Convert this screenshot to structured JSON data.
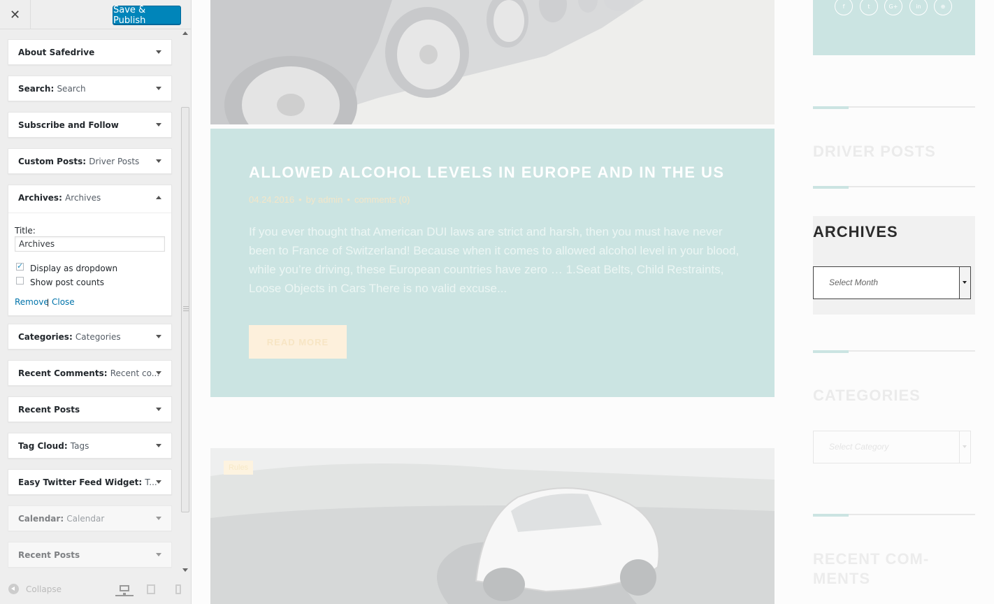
{
  "customizer": {
    "close_label": "✕",
    "save_label": "Save & Publish",
    "widgets": [
      {
        "name": "About Safedrive",
        "subtitle": ""
      },
      {
        "name": "Search",
        "subtitle": "Search"
      },
      {
        "name": "Subscribe and Follow",
        "subtitle": ""
      },
      {
        "name": "Custom Posts",
        "subtitle": "Driver Posts"
      },
      {
        "name": "Archives",
        "subtitle": "Archives"
      },
      {
        "name": "Categories",
        "subtitle": "Categories"
      },
      {
        "name": "Recent Comments",
        "subtitle": "Recent co..."
      },
      {
        "name": "Recent Posts",
        "subtitle": ""
      },
      {
        "name": "Tag Cloud",
        "subtitle": "Tags"
      },
      {
        "name": "Easy Twitter Feed Widget",
        "subtitle": "T..."
      },
      {
        "name": "Calendar",
        "subtitle": "Calendar"
      },
      {
        "name": "Recent Posts",
        "subtitle": ""
      }
    ],
    "archives_form": {
      "title_label": "Title:",
      "title_value": "Archives",
      "display_dropdown_label": "Display as dropdown",
      "display_dropdown_checked": true,
      "show_counts_label": "Show post counts",
      "show_counts_checked": false,
      "remove_label": "Remove",
      "separator": "|",
      "close_label": "Close"
    },
    "footer": {
      "collapse_label": "Collapse",
      "devices": [
        "desktop",
        "tablet",
        "mobile"
      ],
      "active_device": "desktop"
    }
  },
  "preview": {
    "post": {
      "title": "ALLOWED ALCOHOL LEVELS IN EUROPE AND IN THE US",
      "date": "04.24.2016",
      "author": "by admin",
      "comments": "comments (0)",
      "excerpt": "If you ever thought that American DUI laws are strict and harsh, then you must have never been to France of Switzerland! Because when it comes to allowed alcohol level in your blood, while you’re driving, these European countries have zero … 1.Seat Belts, Child Restraints, Loose Objects in Cars There is no valid excuse...",
      "read_more": "READ MORE"
    },
    "second_post": {
      "category_badge": "Rules"
    },
    "sidebar": {
      "social_icons": [
        "f",
        "t",
        "G+",
        "in",
        "⊕"
      ],
      "driver_posts_heading": "DRIVER POSTS",
      "archives_heading": "ARCHIVES",
      "archives_select_placeholder": "Select Month",
      "categories_heading": "CATEGORIES",
      "categories_select_placeholder": "Select Category",
      "recent_comments_heading": "RECENT COM-MENTS"
    }
  },
  "colors": {
    "accent_blue": "#0085ba",
    "link_blue": "#0073aa",
    "mint": "#cbe4e2",
    "cream": "#fdf0dc"
  }
}
